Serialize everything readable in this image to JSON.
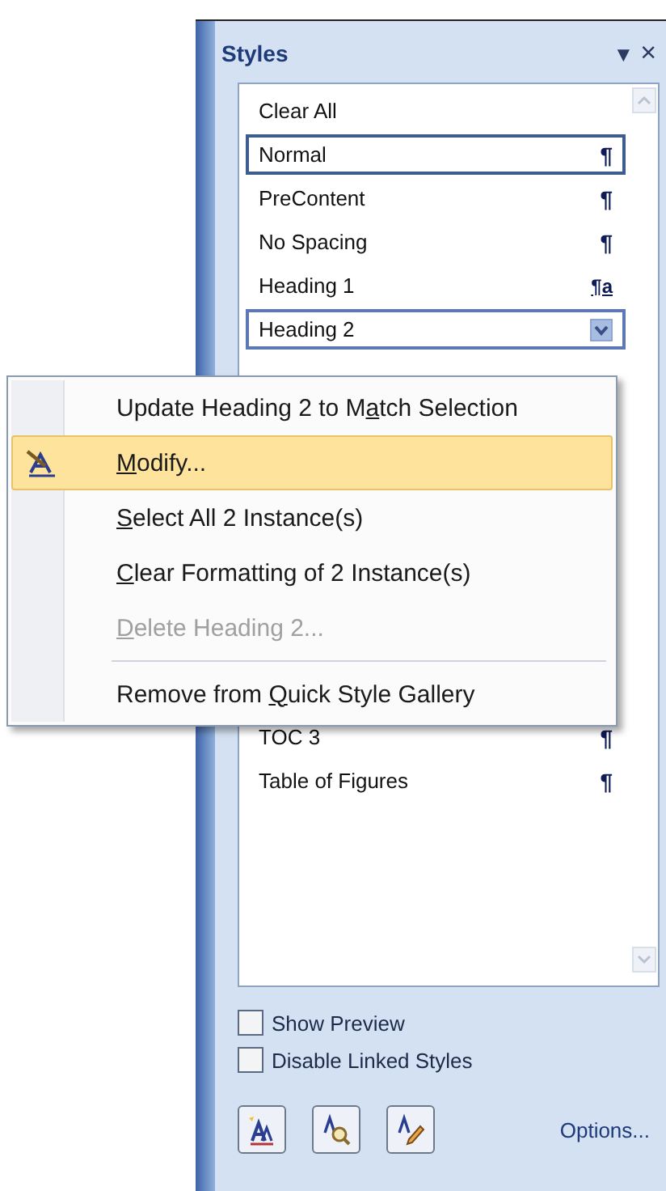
{
  "pane": {
    "title": "Styles",
    "menu_glyph": "▼",
    "close_glyph": "×"
  },
  "items": [
    {
      "label": "Clear All",
      "kind": "none",
      "selected": false,
      "hovered": false
    },
    {
      "label": "Normal",
      "kind": "paragraph",
      "marker": "¶",
      "selected": true,
      "hovered": false
    },
    {
      "label": "PreContent",
      "kind": "paragraph",
      "marker": "¶",
      "selected": false,
      "hovered": false
    },
    {
      "label": "No Spacing",
      "kind": "paragraph",
      "marker": "¶",
      "selected": false,
      "hovered": false
    },
    {
      "label": "Heading 1",
      "kind": "linked",
      "marker": "¶a",
      "selected": false,
      "hovered": false
    },
    {
      "label": "Heading 2",
      "kind": "dropdown",
      "selected": false,
      "hovered": true
    }
  ],
  "items_after_menu": [
    {
      "label": "TOC 3",
      "kind": "paragraph",
      "marker": "¶",
      "selected": false,
      "hovered": false
    },
    {
      "label": "Table of Figures",
      "kind": "paragraph",
      "marker": "¶",
      "selected": false,
      "hovered": false
    }
  ],
  "context_menu": [
    {
      "kind": "item",
      "before": "Update Heading 2 to M",
      "key": "a",
      "after": "tch Selection",
      "selected": false,
      "disabled": false
    },
    {
      "kind": "icon-item",
      "key": "M",
      "after": "odify...",
      "selected": true,
      "disabled": false
    },
    {
      "kind": "item",
      "key": "S",
      "after": "elect All 2 Instance(s)",
      "selected": false,
      "disabled": false
    },
    {
      "kind": "item",
      "key": "C",
      "after": "lear Formatting of 2 Instance(s)",
      "selected": false,
      "disabled": false
    },
    {
      "kind": "item",
      "key": "D",
      "after": "elete Heading 2...",
      "selected": false,
      "disabled": true
    },
    {
      "kind": "separator"
    },
    {
      "kind": "item",
      "before": "Remove from ",
      "key": "Q",
      "after": "uick Style Gallery",
      "selected": false,
      "disabled": false
    }
  ],
  "options": [
    {
      "label": "Show Preview",
      "checked": false
    },
    {
      "label": "Disable Linked Styles",
      "checked": false
    }
  ],
  "toolbar": {
    "link": "Options..."
  }
}
